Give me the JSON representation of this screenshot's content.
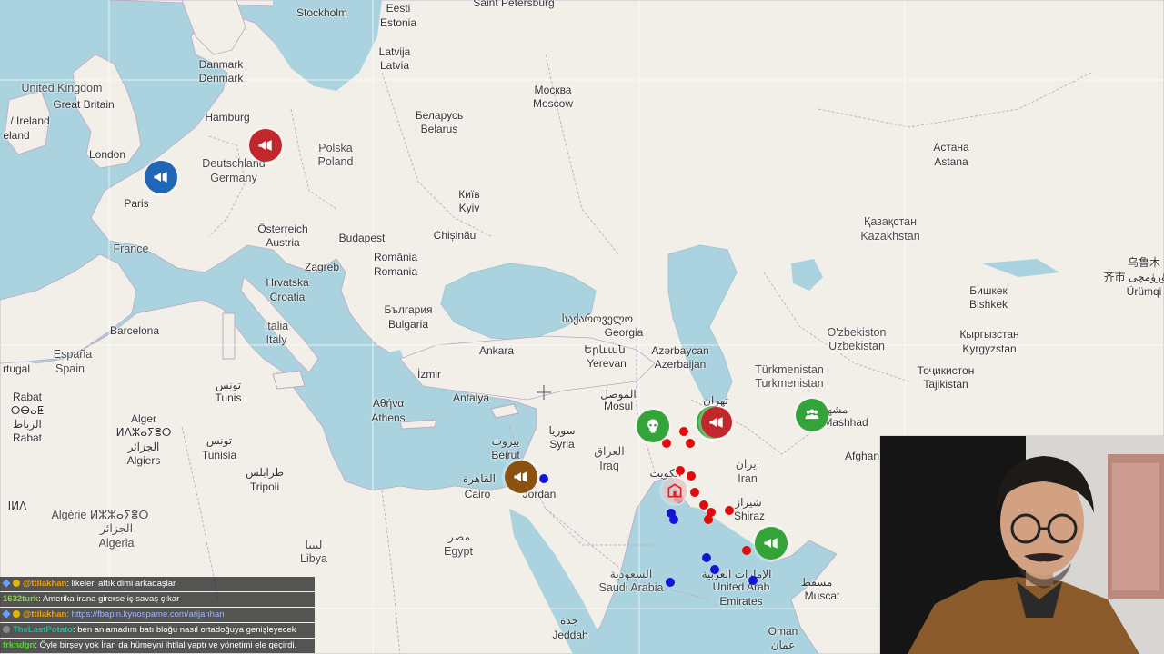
{
  "map": {
    "places": [
      {
        "id": "stockholm",
        "text": "Stockholm"
      },
      {
        "id": "estonia1",
        "text": "Eesti"
      },
      {
        "id": "estonia2",
        "text": "Estonia"
      },
      {
        "id": "spb",
        "text": "Saint Petersburg"
      },
      {
        "id": "latvia1",
        "text": "Latvija"
      },
      {
        "id": "latvia2",
        "text": "Latvia"
      },
      {
        "id": "uk",
        "text": "United Kingdom"
      },
      {
        "id": "gb",
        "text": "Great Britain"
      },
      {
        "id": "denmark1",
        "text": "Danmark"
      },
      {
        "id": "denmark2",
        "text": "Denmark"
      },
      {
        "id": "hamburg",
        "text": "Hamburg"
      },
      {
        "id": "moscow1",
        "text": "Москва"
      },
      {
        "id": "moscow2",
        "text": "Moscow"
      },
      {
        "id": "belarus1",
        "text": "Беларусь"
      },
      {
        "id": "belarus2",
        "text": "Belarus"
      },
      {
        "id": "ireland1",
        "text": "/ Ireland"
      },
      {
        "id": "ireland2",
        "text": "eland"
      },
      {
        "id": "london",
        "text": "London"
      },
      {
        "id": "poland1",
        "text": "Polska"
      },
      {
        "id": "poland2",
        "text": "Poland"
      },
      {
        "id": "germany1",
        "text": "Deutschland"
      },
      {
        "id": "germany2",
        "text": "Germany"
      },
      {
        "id": "paris",
        "text": "Paris"
      },
      {
        "id": "kyiv1",
        "text": "Київ"
      },
      {
        "id": "kyiv2",
        "text": "Kyiv"
      },
      {
        "id": "astana1",
        "text": "Астана"
      },
      {
        "id": "astana2",
        "text": "Astana"
      },
      {
        "id": "austria1",
        "text": "Österreich"
      },
      {
        "id": "austria2",
        "text": "Austria"
      },
      {
        "id": "budapest",
        "text": "Budapest"
      },
      {
        "id": "chisinau",
        "text": "Chișinău"
      },
      {
        "id": "kaz1",
        "text": "Қазақстан"
      },
      {
        "id": "kaz2",
        "text": "Kazakhstan"
      },
      {
        "id": "france",
        "text": "France"
      },
      {
        "id": "zagreb",
        "text": "Zagreb"
      },
      {
        "id": "romania1",
        "text": "România"
      },
      {
        "id": "romania2",
        "text": "Romania"
      },
      {
        "id": "urumqi1",
        "text": "乌鲁木"
      },
      {
        "id": "urumqi2",
        "text": "齐市 ئۈرۈمچی"
      },
      {
        "id": "urumqi3",
        "text": "Ürümqi"
      },
      {
        "id": "croatia1",
        "text": "Hrvatska"
      },
      {
        "id": "croatia2",
        "text": "Croatia"
      },
      {
        "id": "bishkek1",
        "text": "Бишкек"
      },
      {
        "id": "bishkek2",
        "text": "Bishkek"
      },
      {
        "id": "italy1",
        "text": "Italia"
      },
      {
        "id": "italy2",
        "text": "Italy"
      },
      {
        "id": "bulgaria1",
        "text": "България"
      },
      {
        "id": "bulgaria2",
        "text": "Bulgaria"
      },
      {
        "id": "georgia1",
        "text": "საქართველო"
      },
      {
        "id": "georgia2",
        "text": "Georgia"
      },
      {
        "id": "barcelona",
        "text": "Barcelona"
      },
      {
        "id": "uzb1",
        "text": "O'zbekiston"
      },
      {
        "id": "uzb2",
        "text": "Uzbekistan"
      },
      {
        "id": "kyr1",
        "text": "Кыргызстан"
      },
      {
        "id": "kyr2",
        "text": "Kyrgyzstan"
      },
      {
        "id": "spain1",
        "text": "España"
      },
      {
        "id": "spain2",
        "text": "Spain"
      },
      {
        "id": "portugal",
        "text": "rtugal"
      },
      {
        "id": "ankara",
        "text": "Ankara"
      },
      {
        "id": "armenia1",
        "text": "Երևան"
      },
      {
        "id": "armenia2",
        "text": "Yerevan"
      },
      {
        "id": "azer1",
        "text": "Azərbaycan"
      },
      {
        "id": "azer2",
        "text": "Azerbaijan"
      },
      {
        "id": "turkm1",
        "text": "Türkmenistan"
      },
      {
        "id": "turkm2",
        "text": "Turkmenistan"
      },
      {
        "id": "taj1",
        "text": "Тоҷикистон"
      },
      {
        "id": "taj2",
        "text": "Tajikistan"
      },
      {
        "id": "izmir",
        "text": "İzmir"
      },
      {
        "id": "tunis1",
        "text": "تونس"
      },
      {
        "id": "tunis2",
        "text": "Tunis"
      },
      {
        "id": "rabat1",
        "text": "Rabat"
      },
      {
        "id": "rabat2",
        "text": "ⵔⴱⴰⵟ"
      },
      {
        "id": "rabat3",
        "text": "الرباط"
      },
      {
        "id": "rabat4",
        "text": "Rabat"
      },
      {
        "id": "athens1",
        "text": "Αθήνα"
      },
      {
        "id": "athens2",
        "text": "Athens"
      },
      {
        "id": "antalya",
        "text": "Antalya"
      },
      {
        "id": "mosul1",
        "text": "الموصل"
      },
      {
        "id": "mosul2",
        "text": "Mosul"
      },
      {
        "id": "tehran",
        "text": "تهران"
      },
      {
        "id": "mashhad1",
        "text": "مشهد"
      },
      {
        "id": "mashhad2",
        "text": "Mashhad"
      },
      {
        "id": "alger1",
        "text": "Alger"
      },
      {
        "id": "alger2",
        "text": "ⵍⴷⵣⴰⵢⴻⵔ"
      },
      {
        "id": "alger3",
        "text": "الجزائر"
      },
      {
        "id": "alger4",
        "text": "Algiers"
      },
      {
        "id": "tunisia1",
        "text": "تونس"
      },
      {
        "id": "tunisia2",
        "text": "Tunisia"
      },
      {
        "id": "beirut1",
        "text": "بيروت"
      },
      {
        "id": "beirut2",
        "text": "Beirut"
      },
      {
        "id": "syria1",
        "text": "سوريا"
      },
      {
        "id": "syria2",
        "text": "Syria"
      },
      {
        "id": "iraq1",
        "text": "العراق"
      },
      {
        "id": "iraq2",
        "text": "Iraq"
      },
      {
        "id": "afgh",
        "text": "Afghan"
      },
      {
        "id": "tripoli1",
        "text": "طرابلس"
      },
      {
        "id": "tripoli2",
        "text": "Tripoli"
      },
      {
        "id": "kuwait",
        "text": "الكويت"
      },
      {
        "id": "iran1",
        "text": "ایران"
      },
      {
        "id": "iran2",
        "text": "Iran"
      },
      {
        "id": "cairo1",
        "text": "القاهرة"
      },
      {
        "id": "cairo2",
        "text": "Cairo"
      },
      {
        "id": "jordan",
        "text": "Jordan"
      },
      {
        "id": "shiraz1",
        "text": "شیراز"
      },
      {
        "id": "shiraz2",
        "text": "Shiraz"
      },
      {
        "id": "algeria1",
        "text": "Algérie ⵍⵣⵣⴰⵢⴻⵔ"
      },
      {
        "id": "algeria2",
        "text": "الجزائر"
      },
      {
        "id": "algeria3",
        "text": "Algeria"
      },
      {
        "id": "libya1",
        "text": "ليبيا"
      },
      {
        "id": "libya2",
        "text": "Libya"
      },
      {
        "id": "egypt1",
        "text": "مصر"
      },
      {
        "id": "egypt2",
        "text": "Egypt"
      },
      {
        "id": "saudi1",
        "text": "السعودية"
      },
      {
        "id": "saudi2",
        "text": "Saudi Arabia"
      },
      {
        "id": "uae1",
        "text": "الإمارات العربية"
      },
      {
        "id": "uae2",
        "text": "United Arab"
      },
      {
        "id": "uae3",
        "text": "Emirates"
      },
      {
        "id": "muscat1",
        "text": "مسقط"
      },
      {
        "id": "muscat2",
        "text": "Muscat"
      },
      {
        "id": "jeddah1",
        "text": "جدة"
      },
      {
        "id": "jeddah2",
        "text": "Jeddah"
      },
      {
        "id": "oman1",
        "text": "Oman"
      },
      {
        "id": "oman2",
        "text": "عمان"
      },
      {
        "id": "sahara",
        "text": "ⵏⵍⴷ"
      }
    ],
    "marker_icons": {
      "megaphone": "megaphone-icon",
      "skull": "skull-icon",
      "group": "group-icon",
      "building": "building-icon"
    }
  },
  "chat": {
    "messages": [
      {
        "user": "@ttilakhan",
        "text": ": likeleri attık dimi arkadaşlar",
        "user_color": "#e8a317"
      },
      {
        "user": "1632turk",
        "text": ": Amerika irana girerse iç savaş çıkar",
        "user_color": "#8fd14f"
      },
      {
        "user": "@ttilakhan",
        "text": ": https://fbapin.kynospame.com/arijanhan",
        "user_color": "#e8a317"
      },
      {
        "user": "TheLastPotato",
        "text": ": ben anlamadım batı bloğu nasıl ortadoğuya genişleyecek",
        "user_color": "#1abc9c"
      },
      {
        "user": "frkndgn",
        "text": ": Öyle birşey yok İran da hümeyni ihtilal yaptı ve yönetimi ele geçirdi.",
        "user_color": "#4ddb2a"
      }
    ]
  }
}
